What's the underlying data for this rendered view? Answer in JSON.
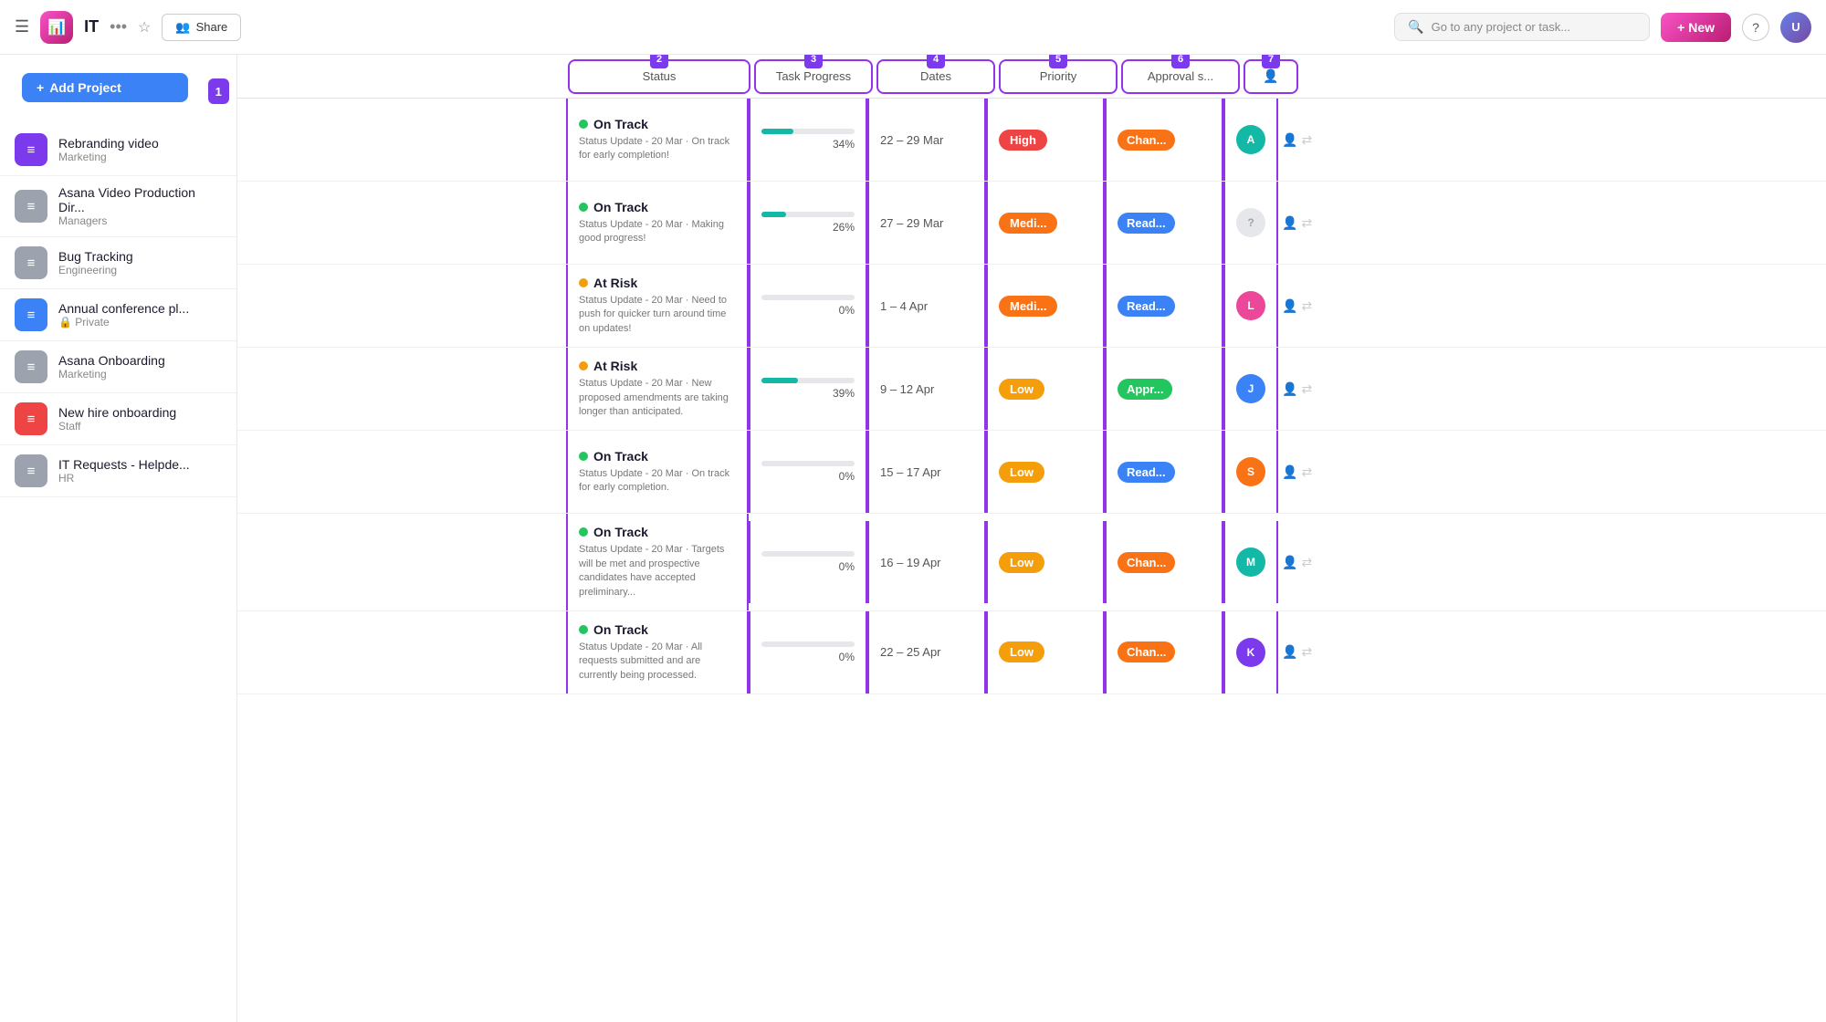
{
  "navbar": {
    "title": "IT",
    "share_label": "Share",
    "search_placeholder": "Go to any project or task...",
    "new_button_label": "+ New"
  },
  "sidebar": {
    "add_project_label": "Add Project",
    "badge_num": "1",
    "items": [
      {
        "id": "rebranding",
        "name": "Rebranding video",
        "sub": "Marketing",
        "icon_type": "purple",
        "icon": "≡"
      },
      {
        "id": "asana-video",
        "name": "Asana Video Production Dir...",
        "sub": "Managers",
        "icon_type": "gray",
        "icon": "≡"
      },
      {
        "id": "bug-tracking",
        "name": "Bug Tracking",
        "sub": "Engineering",
        "icon_type": "gray",
        "icon": "≡"
      },
      {
        "id": "annual-conf",
        "name": "Annual conference pl...",
        "sub": "Private",
        "icon_type": "blue",
        "icon": "≡",
        "private": true
      },
      {
        "id": "asana-onboarding",
        "name": "Asana Onboarding",
        "sub": "Marketing",
        "icon_type": "gray",
        "icon": "≡"
      },
      {
        "id": "new-hire",
        "name": "New hire onboarding",
        "sub": "Staff",
        "icon_type": "red",
        "icon": "≡"
      },
      {
        "id": "it-requests",
        "name": "IT Requests - Helpde...",
        "sub": "HR",
        "icon_type": "gray",
        "icon": "≡"
      }
    ]
  },
  "columns": {
    "num1": "1",
    "num2": "2",
    "num3": "3",
    "num4": "4",
    "num5": "5",
    "num6": "6",
    "num7": "7",
    "status_label": "Status",
    "task_progress_label": "Task Progress",
    "dates_label": "Dates",
    "priority_label": "Priority",
    "approval_label": "Approval s..."
  },
  "rows": [
    {
      "status_type": "green",
      "status_label": "On Track",
      "status_text": "Status Update - 20 Mar · On track for early completion!",
      "progress": 34,
      "dates": "22 – 29 Mar",
      "priority": "High",
      "priority_type": "high",
      "approval": "Chan...",
      "approval_type": "orange",
      "avatar_color": "teal",
      "avatar_letter": "A"
    },
    {
      "status_type": "green",
      "status_label": "On Track",
      "status_text": "Status Update - 20 Mar · Making good progress!",
      "progress": 26,
      "dates": "27 – 29 Mar",
      "priority": "Medi...",
      "priority_type": "medium",
      "approval": "Read...",
      "approval_type": "blue",
      "avatar_color": "ghost",
      "avatar_letter": "?"
    },
    {
      "status_type": "yellow",
      "status_label": "At Risk",
      "status_text": "Status Update - 20 Mar · Need to push for quicker turn around time on updates!",
      "progress": 0,
      "dates": "1 – 4 Apr",
      "priority": "Medi...",
      "priority_type": "medium",
      "approval": "Read...",
      "approval_type": "blue",
      "avatar_color": "pink",
      "avatar_letter": "L"
    },
    {
      "status_type": "yellow",
      "status_label": "At Risk",
      "status_text": "Status Update - 20 Mar · New proposed amendments are taking longer than anticipated.",
      "progress": 39,
      "dates": "9 – 12 Apr",
      "priority": "Low",
      "priority_type": "low",
      "approval": "Appr...",
      "approval_type": "green",
      "avatar_color": "blue",
      "avatar_letter": "J"
    },
    {
      "status_type": "green",
      "status_label": "On Track",
      "status_text": "Status Update - 20 Mar · On track for early completion.",
      "progress": 0,
      "dates": "15 – 17 Apr",
      "priority": "Low",
      "priority_type": "low",
      "approval": "Read...",
      "approval_type": "blue",
      "avatar_color": "orange",
      "avatar_letter": "S"
    },
    {
      "status_type": "green",
      "status_label": "On Track",
      "status_text": "Status Update - 20 Mar · Targets will be met and prospective candidates have accepted preliminary...",
      "progress": 0,
      "dates": "16 – 19 Apr",
      "priority": "Low",
      "priority_type": "low",
      "approval": "Chan...",
      "approval_type": "orange",
      "avatar_color": "teal",
      "avatar_letter": "M"
    },
    {
      "status_type": "green",
      "status_label": "On Track",
      "status_text": "Status Update - 20 Mar · All requests submitted and are currently being processed.",
      "progress": 0,
      "dates": "22 – 25 Apr",
      "priority": "Low",
      "priority_type": "low",
      "approval": "Chan...",
      "approval_type": "orange",
      "avatar_color": "purple",
      "avatar_letter": "K"
    }
  ]
}
